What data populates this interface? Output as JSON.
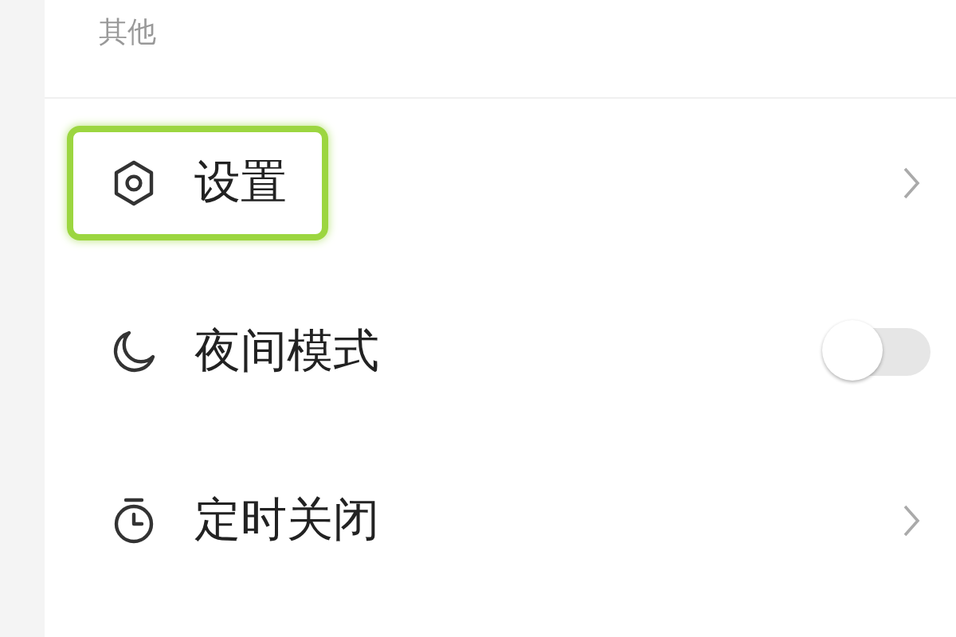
{
  "section": {
    "title": "其他"
  },
  "items": [
    {
      "kind": "link",
      "label": "设置",
      "highlighted": true
    },
    {
      "kind": "toggle",
      "label": "夜间模式",
      "on": false,
      "highlighted": false
    },
    {
      "kind": "link",
      "label": "定时关闭",
      "highlighted": false
    }
  ]
}
